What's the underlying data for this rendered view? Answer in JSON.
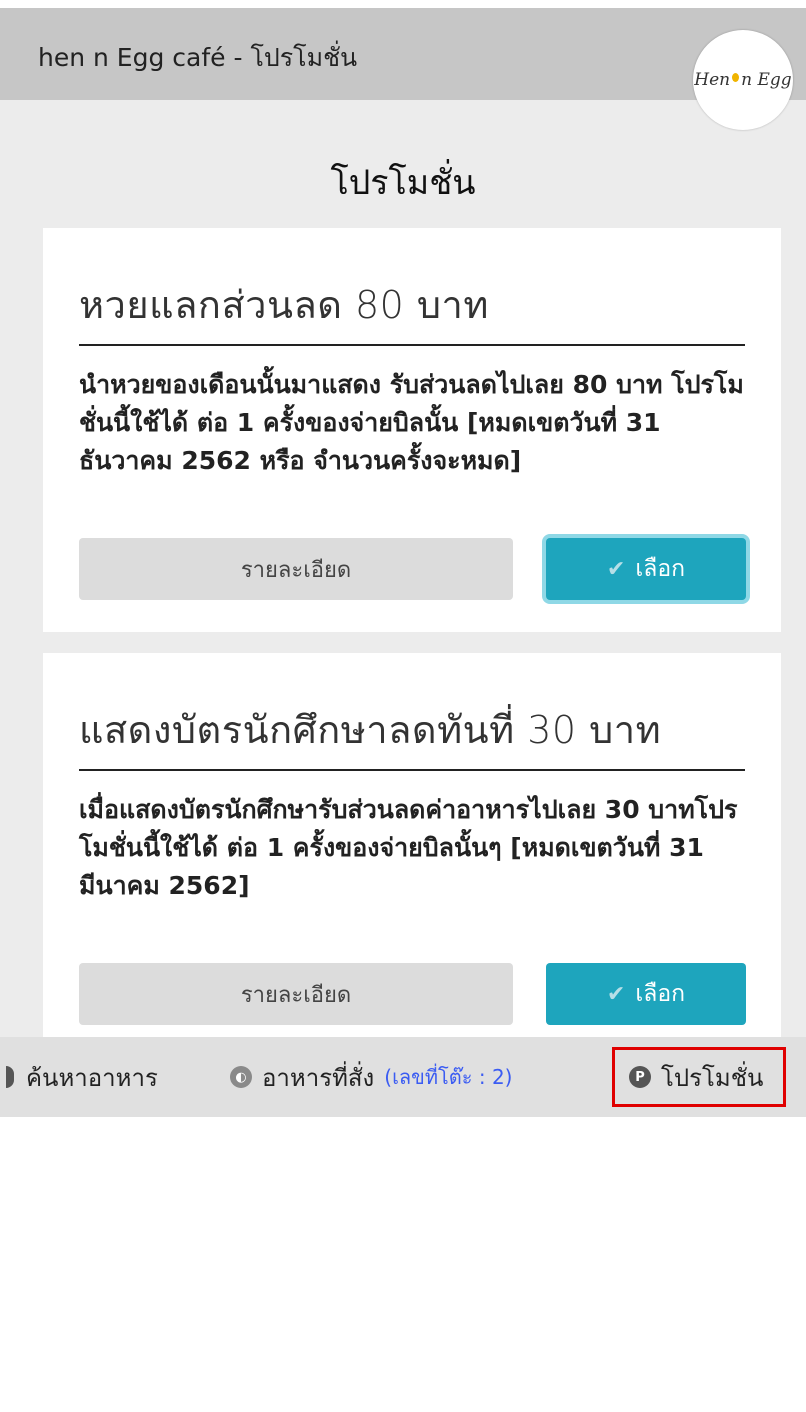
{
  "header": {
    "title": "hen n Egg café - โปรโมชั่น",
    "logo_text_1": "Hen",
    "logo_text_2": "n",
    "logo_text_3": "Egg"
  },
  "page": {
    "title": "โปรโมชั่น"
  },
  "promotions": [
    {
      "title": "หวยแลกส่วนลด 80 บาท",
      "description": "นำหวยของเดือนนั้นมาแสดง รับส่วนลดไปเลย 80 บาท โปรโมชั่นนี้ใช้ได้ ต่อ 1 ครั้งของจ่ายบิลนั้น [หมดเขตวันที่ 31 ธันวาคม 2562 หรือ จำนวนครั้งจะหมด]",
      "detail_label": "รายละเอียด",
      "select_label": "เลือก"
    },
    {
      "title": "แสดงบัตรนักศึกษาลดทันที่ 30 บาท",
      "description": "เมื่อแสดงบัตรนักศึกษารับส่วนลดค่าอาหารไปเลย 30 บาทโปรโมชั่นนี้ใช้ได้ ต่อ 1 ครั้งของจ่ายบิลนั้นๆ [หมดเขตวันที่ 31 มีนาคม 2562]",
      "detail_label": "รายละเอียด",
      "select_label": "เลือก"
    }
  ],
  "bottom_nav": {
    "search_label": "ค้นหาอาหาร",
    "orders_label": "อาหารที่สั่ง",
    "table_note": "(เลขที่โต๊ะ : 2)",
    "promo_label": "โปรโมชั่น",
    "promo_icon_letter": "P"
  },
  "colors": {
    "header_bg": "#c6c6c6",
    "select_button": "#1ea5bd",
    "highlight_border": "#e00000",
    "table_note": "#3b5cf2"
  },
  "icons": {
    "select": "check-icon",
    "orders": "orders-icon",
    "promo": "promo-p-icon",
    "search": "search-icon"
  }
}
